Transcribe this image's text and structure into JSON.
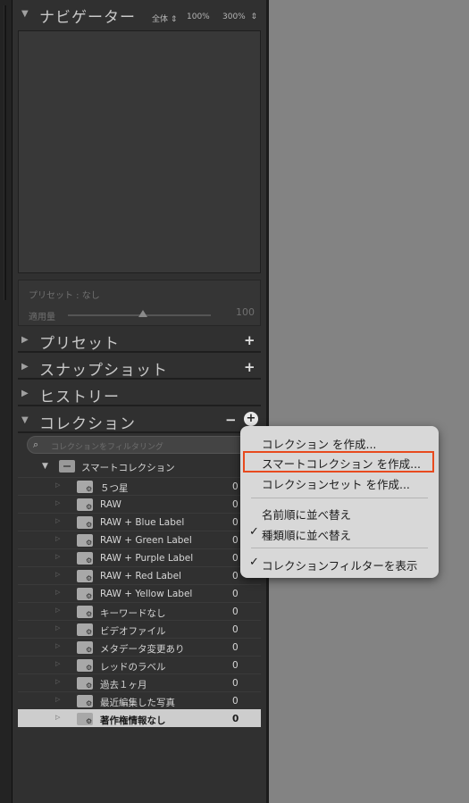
{
  "navigator": {
    "title": "ナビゲーター",
    "opt_fit": "全体",
    "opt_100": "100%",
    "opt_300": "300%"
  },
  "preset_info": {
    "label": "プリセット : なし",
    "amount_label": "適用量",
    "amount_value": "100"
  },
  "sections": {
    "presets": "プリセット",
    "snapshots": "スナップショット",
    "history": "ヒストリー",
    "collections": "コレクション"
  },
  "collections": {
    "search_placeholder": "コレクションをフィルタリング",
    "smart_parent": "スマートコレクション",
    "items": [
      {
        "name": "５つ星",
        "count": "0"
      },
      {
        "name": "RAW",
        "count": "0"
      },
      {
        "name": "RAW + Blue Label",
        "count": "0"
      },
      {
        "name": "RAW + Green Label",
        "count": "0"
      },
      {
        "name": "RAW + Purple Label",
        "count": "0"
      },
      {
        "name": "RAW + Red Label",
        "count": "0"
      },
      {
        "name": "RAW + Yellow Label",
        "count": "0"
      },
      {
        "name": "キーワードなし",
        "count": "0"
      },
      {
        "name": "ビデオファイル",
        "count": "0"
      },
      {
        "name": "メタデータ変更あり",
        "count": "0"
      },
      {
        "name": "レッドのラベル",
        "count": "0"
      },
      {
        "name": "過去１ヶ月",
        "count": "0"
      },
      {
        "name": "最近編集した写真",
        "count": "0"
      },
      {
        "name": "著作権情報なし",
        "count": "0"
      }
    ]
  },
  "context_menu": {
    "create_collection": "コレクション を作成...",
    "create_smart_collection": "スマートコレクション を作成...",
    "create_collection_set": "コレクションセット を作成...",
    "sort_by_name": "名前順に並べ替え",
    "sort_by_kind": "種類順に並べ替え",
    "show_filter": "コレクションフィルターを表示",
    "highlight_color": "#e84a1e"
  }
}
